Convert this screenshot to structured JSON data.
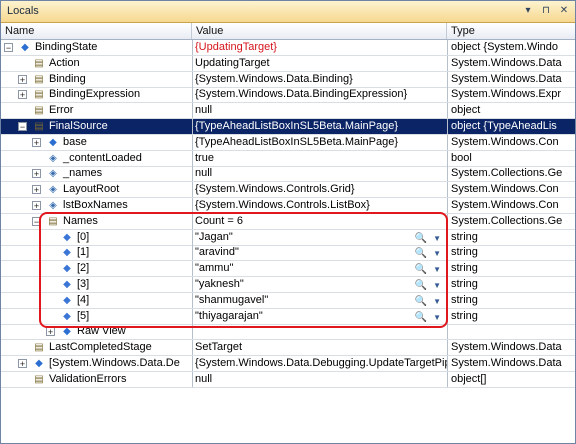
{
  "window": {
    "title": "Locals"
  },
  "toolbar_icons": [
    "dropdown-icon",
    "pin-icon",
    "close-icon"
  ],
  "columns": {
    "name": "Name",
    "value": "Value",
    "type": "Type"
  },
  "rows": [
    {
      "name": "BindingState",
      "value": "{UpdatingTarget}",
      "type": "object {System.Windo",
      "level": 0,
      "expander": "minus",
      "icon": "diamond",
      "value_red": true
    },
    {
      "name": "Action",
      "value": "UpdatingTarget",
      "type": "System.Windows.Data",
      "level": 1,
      "expander": "none",
      "icon": "prop"
    },
    {
      "name": "Binding",
      "value": "{System.Windows.Data.Binding}",
      "type": "System.Windows.Data",
      "level": 1,
      "expander": "plus",
      "icon": "prop"
    },
    {
      "name": "BindingExpression",
      "value": "{System.Windows.Data.BindingExpression}",
      "type": "System.Windows.Expr",
      "level": 1,
      "expander": "plus",
      "icon": "prop"
    },
    {
      "name": "Error",
      "value": "null",
      "type": "object",
      "level": 1,
      "expander": "none",
      "icon": "prop"
    },
    {
      "name": "FinalSource",
      "value": "{TypeAheadListBoxInSL5Beta.MainPage}",
      "type": "object {TypeAheadLis",
      "level": 1,
      "expander": "minus",
      "icon": "prop",
      "selected": true
    },
    {
      "name": "base",
      "value": "{TypeAheadListBoxInSL5Beta.MainPage}",
      "type": "System.Windows.Con",
      "level": 2,
      "expander": "plus",
      "icon": "diamond"
    },
    {
      "name": "_contentLoaded",
      "value": "true",
      "type": "bool",
      "level": 2,
      "expander": "none",
      "icon": "lock"
    },
    {
      "name": "_names",
      "value": "null",
      "type": "System.Collections.Ge",
      "level": 2,
      "expander": "plus",
      "icon": "lock"
    },
    {
      "name": "LayoutRoot",
      "value": "{System.Windows.Controls.Grid}",
      "type": "System.Windows.Con",
      "level": 2,
      "expander": "plus",
      "icon": "lock"
    },
    {
      "name": "lstBoxNames",
      "value": "{System.Windows.Controls.ListBox}",
      "type": "System.Windows.Con",
      "level": 2,
      "expander": "plus",
      "icon": "lock"
    },
    {
      "name": "Names",
      "value": "Count = 6",
      "type": "System.Collections.Ge",
      "level": 2,
      "expander": "minus",
      "icon": "prop"
    },
    {
      "name": "[0]",
      "value": "\"Jagan\"",
      "type": "string",
      "level": 3,
      "expander": "none",
      "icon": "field",
      "mag": true
    },
    {
      "name": "[1]",
      "value": "\"aravind\"",
      "type": "string",
      "level": 3,
      "expander": "none",
      "icon": "field",
      "mag": true
    },
    {
      "name": "[2]",
      "value": "\"ammu\"",
      "type": "string",
      "level": 3,
      "expander": "none",
      "icon": "field",
      "mag": true
    },
    {
      "name": "[3]",
      "value": "\"yaknesh\"",
      "type": "string",
      "level": 3,
      "expander": "none",
      "icon": "field",
      "mag": true
    },
    {
      "name": "[4]",
      "value": "\"shanmugavel\"",
      "type": "string",
      "level": 3,
      "expander": "none",
      "icon": "field",
      "mag": true
    },
    {
      "name": "[5]",
      "value": "\"thiyagarajan\"",
      "type": "string",
      "level": 3,
      "expander": "none",
      "icon": "field",
      "mag": true
    },
    {
      "name": "Raw View",
      "value": "",
      "type": "",
      "level": 3,
      "expander": "plus",
      "icon": "diamond"
    },
    {
      "name": "LastCompletedStage",
      "value": "SetTarget",
      "type": "System.Windows.Data",
      "level": 1,
      "expander": "none",
      "icon": "prop"
    },
    {
      "name": "[System.Windows.Data.De",
      "value": "{System.Windows.Data.Debugging.UpdateTargetPip",
      "type": "System.Windows.Data",
      "level": 1,
      "expander": "plus",
      "icon": "diamond"
    },
    {
      "name": "ValidationErrors",
      "value": "null",
      "type": "object[]",
      "level": 1,
      "expander": "none",
      "icon": "prop"
    }
  ]
}
